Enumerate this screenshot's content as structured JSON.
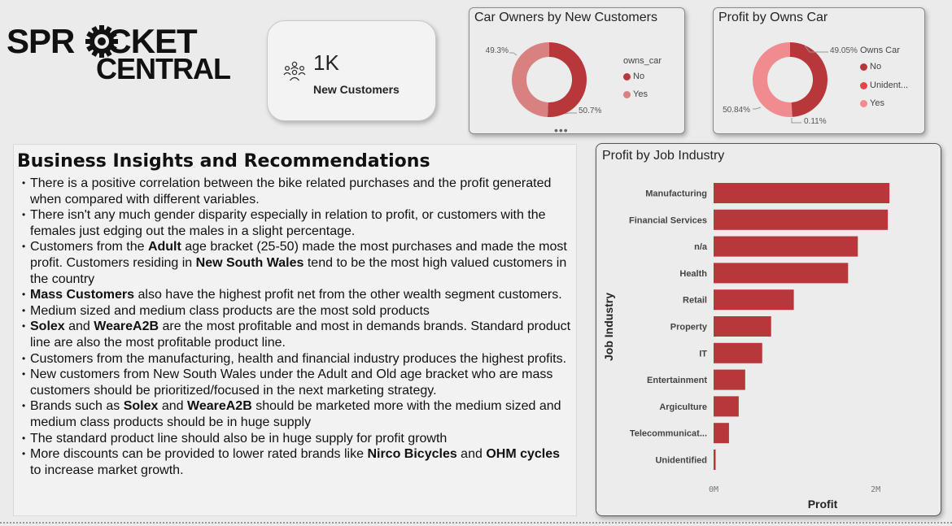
{
  "logo": {
    "line1": "SPR",
    "line1b": "CKET",
    "line2": "CENTRAL"
  },
  "kpi": {
    "value": "1K",
    "label": "New Customers",
    "icon": "people-group-icon"
  },
  "more_options": "•••",
  "colors": {
    "dark_red": "#b8373a",
    "light_red": "#d98080",
    "pink": "#f08b8f",
    "mid_red": "#e0464c"
  },
  "owners_chart": {
    "title": "Car Owners by New Customers",
    "legend_title": "owns_car",
    "legend": [
      "No",
      "Yes"
    ],
    "slice_labels": [
      "50.7%",
      "49.3%"
    ]
  },
  "profit_car_chart": {
    "title": "Profit by Owns Car",
    "legend_title": "Owns Car",
    "legend": [
      "No",
      "Unident...",
      "Yes"
    ],
    "slice_labels": [
      "49.05%",
      "0.11%",
      "50.84%"
    ]
  },
  "insights": {
    "title": "Business Insights and Recommendations",
    "items": [
      [
        {
          "t": "There is a positive correlation between the bike related purchases and the profit generated when compared with different variables."
        }
      ],
      [
        {
          "t": " There isn't any much gender disparity especially in relation to profit, or customers with the females just edging out the males in a slight percentage."
        }
      ],
      [
        {
          "t": "Customers from the "
        },
        {
          "t": "Adult",
          "b": true
        },
        {
          "t": " age bracket (25-50) made the most purchases and made the most profit. Customers residing in "
        },
        {
          "t": "New South Wales",
          "b": true
        },
        {
          "t": " tend to be the most high valued customers in the country"
        }
      ],
      [
        {
          "t": "Mass Customers",
          "b": true
        },
        {
          "t": " also have the highest profit net from the other wealth segment customers."
        }
      ],
      [
        {
          "t": "Medium sized and medium class products are the most sold products"
        }
      ],
      [
        {
          "t": "Solex",
          "b": true
        },
        {
          "t": " and "
        },
        {
          "t": "WeareA2B",
          "b": true
        },
        {
          "t": " are the most profitable and most in demands brands. Standard product line are also the most profitable product line."
        }
      ],
      [
        {
          "t": "Customers from the manufacturing, health and financial industry produces the highest profits."
        }
      ],
      [
        {
          "t": "New customers from New South Wales under the Adult and Old age bracket who are mass customers should be prioritized/focused in the next marketing strategy."
        }
      ],
      [
        {
          "t": "Brands such as "
        },
        {
          "t": "Solex",
          "b": true
        },
        {
          "t": " and "
        },
        {
          "t": "WeareA2B",
          "b": true
        },
        {
          "t": " should be marketed more with the medium sized and medium class products should be in huge supply"
        }
      ],
      [
        {
          "t": "The standard product line should also be in huge supply for profit growth"
        }
      ],
      [
        {
          "t": "More discounts can be provided to lower rated brands like "
        },
        {
          "t": "Nirco Bicycles",
          "b": true
        },
        {
          "t": " and "
        },
        {
          "t": "OHM cycles",
          "b": true
        },
        {
          "t": " to increase market growth."
        }
      ]
    ]
  },
  "chart_data": [
    {
      "type": "pie",
      "title": "Car Owners by New Customers",
      "legend_title": "owns_car",
      "categories": [
        "No",
        "Yes"
      ],
      "values": [
        50.7,
        49.3
      ],
      "labels": [
        "50.7%",
        "49.3%"
      ],
      "colors": [
        "#b8373a",
        "#d98080"
      ],
      "donut": true,
      "legend_position": "right"
    },
    {
      "type": "pie",
      "title": "Profit by Owns Car",
      "legend_title": "Owns Car",
      "categories": [
        "No",
        "Unidentified",
        "Yes"
      ],
      "values": [
        49.05,
        0.11,
        50.84
      ],
      "labels": [
        "49.05%",
        "0.11%",
        "50.84%"
      ],
      "colors": [
        "#b8373a",
        "#e0464c",
        "#f08b8f"
      ],
      "donut": true,
      "legend_position": "right"
    },
    {
      "type": "bar",
      "orientation": "horizontal",
      "title": "Profit by Job Industry",
      "xlabel": "Profit",
      "ylabel": "Job Industry",
      "categories": [
        "Manufacturing",
        "Financial Services",
        "n/a",
        "Health",
        "Retail",
        "Property",
        "IT",
        "Entertainment",
        "Argiculture",
        "Telecommunicat...",
        "Unidentified"
      ],
      "values": [
        2170000,
        2150000,
        1780000,
        1660000,
        990000,
        710000,
        600000,
        390000,
        310000,
        190000,
        25000
      ],
      "xlim": [
        0,
        2400000
      ],
      "xticks": [
        0,
        2000000
      ],
      "xtick_labels": [
        "0M",
        "2M"
      ],
      "grid": false,
      "color": "#b8373a"
    }
  ]
}
